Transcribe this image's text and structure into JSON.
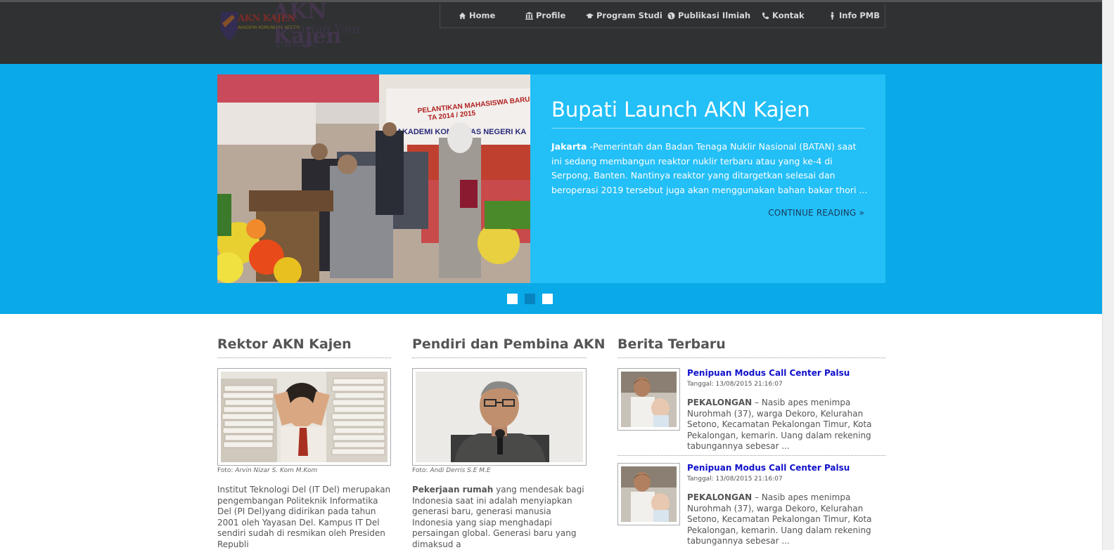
{
  "logo": {
    "line1": "AKN KAJEN",
    "line1_big": "AKN Kajen",
    "line2": "AKADEMI KOMUNITAS NEGERI",
    "tagline": "Securing Your Future"
  },
  "nav": [
    {
      "label": "Home",
      "icon": "home-icon"
    },
    {
      "label": "Profile",
      "icon": "building-icon"
    },
    {
      "label": "Program Studi",
      "icon": "graduation-cap-icon"
    },
    {
      "label": "Publikasi Ilmiah",
      "icon": "globe-icon"
    },
    {
      "label": "Kontak",
      "icon": "phone-icon"
    },
    {
      "label": "Info PMB",
      "icon": "male-icon"
    }
  ],
  "hero": {
    "title": "Bupati Launch AKN Kajen",
    "lead": "Jakarta",
    "text": " -Pemerintah dan Badan Tenaga Nuklir Nasional (BATAN) saat ini sedang membangun reaktor nuklir terbaru atau yang ke-4 di Serpong, Banten. Nantinya reaktor yang ditargetkan selesai dan beroperasi 2019 tersebut juga akan menggunakan bahan bakar thori ...",
    "more": "CONTINUE READING »",
    "banner_line1": "PELANTIKAN MAHASISWA BARU",
    "banner_line2": "TA 2014 / 2015",
    "banner_line3": "AKADEMI KOMUNITAS NEGERI KA",
    "active_slide": 2,
    "slide_count": 3
  },
  "rektor": {
    "title": "Rektor AKN Kajen",
    "caption_prefix": "Foto:",
    "caption_name": "Arvin Nizar S. Kom M.Kom",
    "text": "Institut Teknologi Del (IT Del) merupakan pengembangan Politeknik Informatika Del (PI Del)yang didirikan pada tahun 2001 oleh Yayasan Del. Kampus IT Del sendiri sudah di resmikan oleh Presiden Republi"
  },
  "pendiri": {
    "title": "Pendiri dan Pembina AKN",
    "caption_prefix": "Foto:",
    "caption_name": "Andi Derris S.E M.E",
    "lead": "Pekerjaan rumah",
    "text": " yang mendesak bagi Indonesia saat ini adalah menyiapkan generasi baru, generasi manusia Indonesia yang siap menghadapi persaingan global. Generasi baru yang dimaksud a"
  },
  "berita": {
    "title": "Berita Terbaru",
    "items": [
      {
        "title": "Penipuan Modus Call Center Palsu",
        "date": "Tanggal: 13/08/2015 21:16:07",
        "lead": "PEKALONGAN",
        "text": " – Nasib apes menimpa Nurohmah (37), warga Dekoro, Kelurahan Setono, Kecamatan Pekalongan Timur, Kota Pekalongan, kemarin. Uang dalam rekening tabungannya sebesar ..."
      },
      {
        "title": "Penipuan Modus Call Center Palsu",
        "date": "Tanggal: 13/08/2015 21:16:07",
        "lead": "PEKALONGAN",
        "text": " – Nasib apes menimpa Nurohmah (37), warga Dekoro, Kelurahan Setono, Kecamatan Pekalongan Timur, Kota Pekalongan, kemarin. Uang dalam rekening tabungannya sebesar ..."
      }
    ]
  },
  "colors": {
    "topbar": "#303132",
    "hero_bg": "#0aa9e8",
    "hero_card": "#23bff7",
    "news_link": "#1010cc"
  }
}
